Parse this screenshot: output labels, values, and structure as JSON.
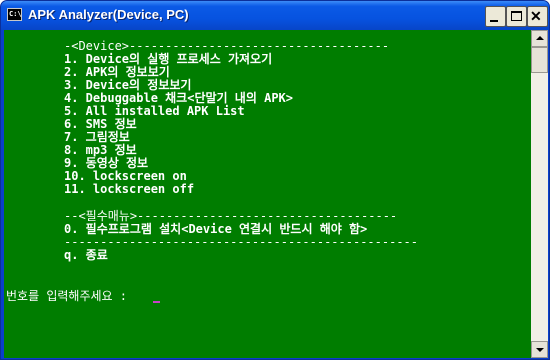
{
  "window": {
    "title": "APK Analyzer(Device, PC)",
    "icon_label": "C:\\",
    "buttons": {
      "minimize": "minimize-icon",
      "maximize": "maximize-icon",
      "close": "close-icon"
    }
  },
  "console": {
    "device_header": "-<Device>------------------------------------",
    "menu_items": [
      "1. Device의 실행 프로세스 가져오기",
      "2. APK의 정보보기",
      "3. Device의 정보보기",
      "4. Debuggable 채크<단말기 내의 APK>",
      "5. All installed APK List",
      "6. SMS 정보",
      "7. 그림정보",
      "8. mp3 정보",
      "9. 동영상 정보",
      "10. lockscreen on",
      "11. lockscreen off"
    ],
    "required_header": "--<필수매뉴>------------------------------------",
    "required_item": "0. 필수프로그램 설치<Device 연결시 반드시 해야 함>",
    "separator": "-------------------------------------------------",
    "quit_item": "q. 종료",
    "prompt": "번호를 입력해주세요 : "
  },
  "colors": {
    "console_background": "#007d00",
    "console_text": "#ffffff",
    "title_bar": "#0753e0",
    "cursor": "#c840c8"
  }
}
